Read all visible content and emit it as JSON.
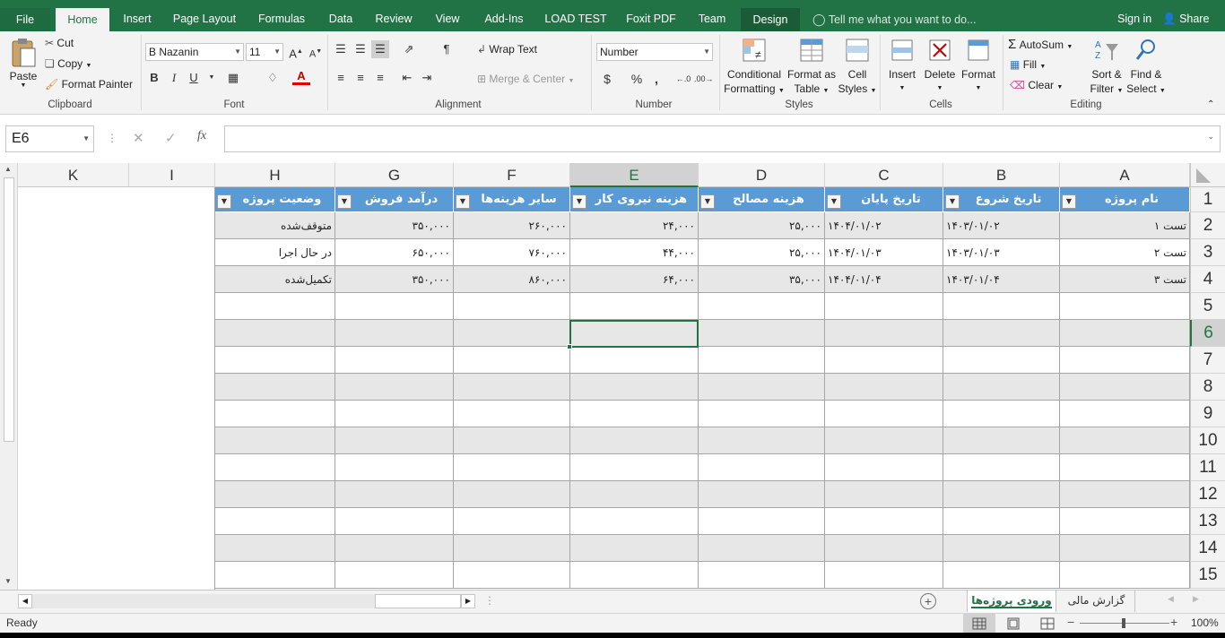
{
  "ribbon_tabs": [
    "File",
    "Home",
    "Insert",
    "Page Layout",
    "Formulas",
    "Data",
    "Review",
    "View",
    "Add-Ins",
    "LOAD TEST",
    "Foxit PDF",
    "Team",
    "Design"
  ],
  "tell_me": "Tell me what you want to do...",
  "sign_in": "Sign in",
  "share": "Share",
  "clipboard": {
    "paste": "Paste",
    "cut": "Cut",
    "copy": "Copy",
    "format_painter": "Format Painter",
    "label": "Clipboard"
  },
  "font": {
    "name": "B Nazanin",
    "size": "11",
    "label": "Font",
    "bold": "B",
    "italic": "I",
    "underline": "U"
  },
  "alignment": {
    "wrap_text": "Wrap Text",
    "merge_center": "Merge & Center",
    "label": "Alignment"
  },
  "number": {
    "format": "Number",
    "currency": "$",
    "percent": "%",
    "comma": ",",
    "label": "Number"
  },
  "styles": {
    "conditional_1": "Conditional",
    "conditional_2": "Formatting",
    "format_table_1": "Format as",
    "format_table_2": "Table",
    "cell_styles_1": "Cell",
    "cell_styles_2": "Styles",
    "label": "Styles"
  },
  "cells": {
    "insert": "Insert",
    "delete": "Delete",
    "format": "Format",
    "label": "Cells"
  },
  "editing": {
    "autosum": "AutoSum",
    "fill": "Fill",
    "clear": "Clear",
    "sort_1": "Sort &",
    "sort_2": "Filter",
    "find_1": "Find &",
    "find_2": "Select",
    "label": "Editing"
  },
  "formula_bar": {
    "name_box": "E6",
    "fx": "fx",
    "cancel": "✕",
    "enter": "✓",
    "value": ""
  },
  "columns": [
    "K",
    "I",
    "H",
    "G",
    "F",
    "E",
    "D",
    "C",
    "B",
    "A"
  ],
  "table_headers": [
    "وضعیت پروژه",
    "درآمد فروش",
    "سایر هزینه‌ها",
    "هزینه نیروی کار",
    "هزینه مصالح",
    "تاریخ پایان",
    "تاریخ شروع",
    "نام پروژه"
  ],
  "table_rows": [
    [
      "متوقف‌شده",
      "۳۵۰,۰۰۰",
      "۲۶۰,۰۰۰",
      "۲۴,۰۰۰",
      "۲۵,۰۰۰",
      "۱۴۰۴/۰۱/۰۲",
      "۱۴۰۳/۰۱/۰۲",
      "تست ۱"
    ],
    [
      "در حال اجرا",
      "۶۵۰,۰۰۰",
      "۷۶۰,۰۰۰",
      "۴۴,۰۰۰",
      "۲۵,۰۰۰",
      "۱۴۰۴/۰۱/۰۳",
      "۱۴۰۳/۰۱/۰۳",
      "تست ۲"
    ],
    [
      "تکمیل‌شده",
      "۳۵۰,۰۰۰",
      "۸۶۰,۰۰۰",
      "۶۴,۰۰۰",
      "۳۵,۰۰۰",
      "۱۴۰۴/۰۱/۰۴",
      "۱۴۰۳/۰۱/۰۴",
      "تست ۳"
    ]
  ],
  "row_numbers": [
    "1",
    "2",
    "3",
    "4",
    "5",
    "6",
    "7",
    "8",
    "9",
    "10",
    "11",
    "12",
    "13",
    "14",
    "15"
  ],
  "active_cell": "E6",
  "sheet_tabs": [
    "ورودی پروژه‌ها",
    "گزارش مالی"
  ],
  "active_sheet": "ورودی پروژه‌ها",
  "status": {
    "ready": "Ready",
    "zoom": "100%"
  },
  "colors": {
    "excel_green": "#217346",
    "table_header": "#5b9bd5",
    "band": "#e7e7e7"
  }
}
